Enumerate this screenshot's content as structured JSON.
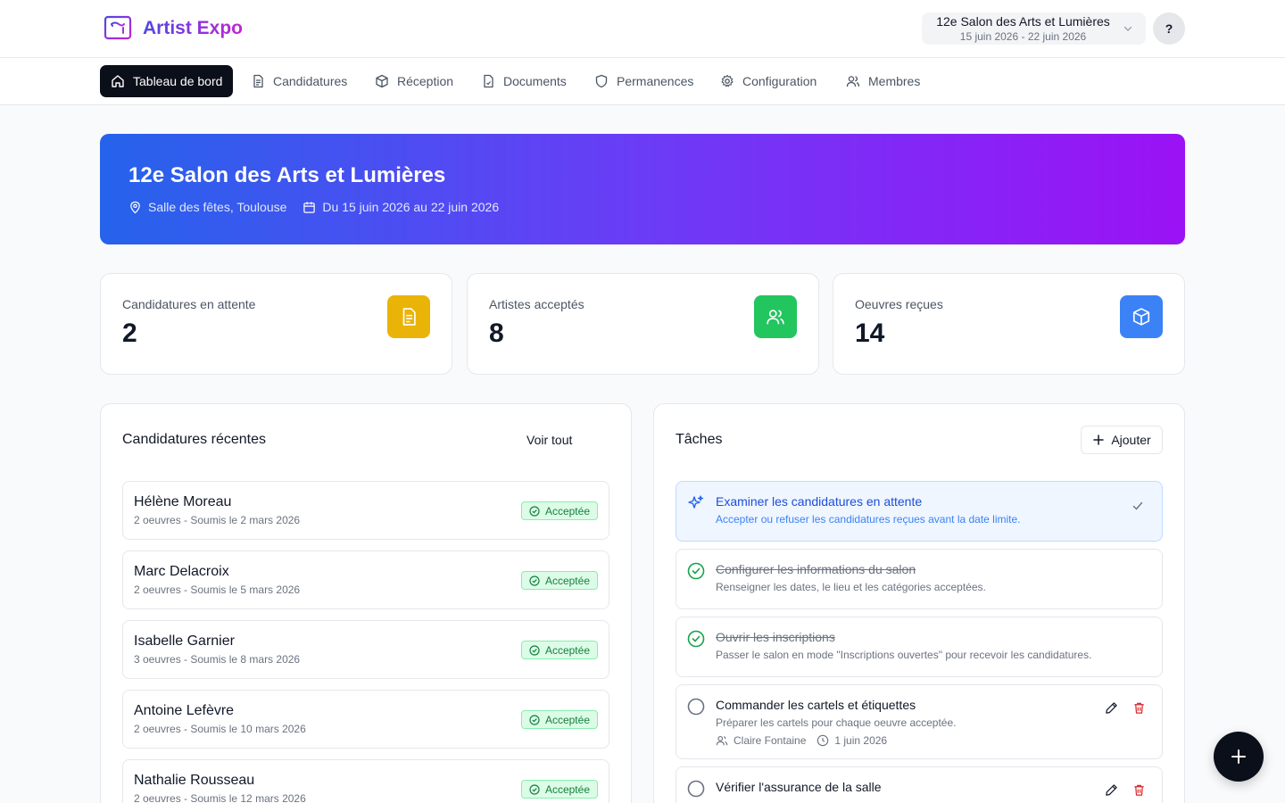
{
  "app": {
    "name": "Artist Expo"
  },
  "event_selector": {
    "name": "12e Salon des Arts et Lumières",
    "dates": "15 juin 2026 - 22 juin 2026"
  },
  "help": {
    "label": "?"
  },
  "nav": {
    "tabs": [
      {
        "label": "Tableau de bord",
        "icon": "home-icon",
        "active": true
      },
      {
        "label": "Candidatures",
        "icon": "document-icon"
      },
      {
        "label": "Réception",
        "icon": "package-icon"
      },
      {
        "label": "Documents",
        "icon": "file-icon"
      },
      {
        "label": "Permanences",
        "icon": "shield-icon"
      },
      {
        "label": "Configuration",
        "icon": "gear-icon"
      },
      {
        "label": "Membres",
        "icon": "users-icon"
      }
    ]
  },
  "banner": {
    "title": "12e Salon des Arts et Lumières",
    "location": "Salle des fêtes, Toulouse",
    "dates": "Du 15 juin 2026 au 22 juin 2026"
  },
  "stats": [
    {
      "label": "Candidatures en attente",
      "value": "2",
      "color": "#eab308",
      "icon": "document-icon"
    },
    {
      "label": "Artistes acceptés",
      "value": "8",
      "color": "#22c55e",
      "icon": "users-icon"
    },
    {
      "label": "Oeuvres reçues",
      "value": "14",
      "color": "#3b82f6",
      "icon": "package-icon"
    }
  ],
  "recent": {
    "title": "Candidatures récentes",
    "see_all": "Voir tout",
    "items": [
      {
        "name": "Hélène Moreau",
        "sub": "2 oeuvres - Soumis le 2 mars 2026",
        "status": "Acceptée"
      },
      {
        "name": "Marc Delacroix",
        "sub": "2 oeuvres - Soumis le 5 mars 2026",
        "status": "Acceptée"
      },
      {
        "name": "Isabelle Garnier",
        "sub": "3 oeuvres - Soumis le 8 mars 2026",
        "status": "Acceptée"
      },
      {
        "name": "Antoine Lefèvre",
        "sub": "2 oeuvres - Soumis le 10 mars 2026",
        "status": "Acceptée"
      },
      {
        "name": "Nathalie Rousseau",
        "sub": "2 oeuvres - Soumis le 12 mars 2026",
        "status": "Acceptée"
      }
    ]
  },
  "tasks": {
    "title": "Tâches",
    "add_label": "Ajouter",
    "items": [
      {
        "title": "Examiner les candidatures en attente",
        "desc": "Accepter ou refuser les candidatures reçues avant la date limite.",
        "state": "highlight"
      },
      {
        "title": "Configurer les informations du salon",
        "desc": "Renseigner les dates, le lieu et les catégories acceptées.",
        "state": "done"
      },
      {
        "title": "Ouvrir les inscriptions",
        "desc": "Passer le salon en mode \"Inscriptions ouvertes\" pour recevoir les candidatures.",
        "state": "done"
      },
      {
        "title": "Commander les cartels et étiquettes",
        "desc": "Préparer les cartels pour chaque oeuvre acceptée.",
        "assignee": "Claire Fontaine",
        "due": "1 juin 2026",
        "state": "todo"
      },
      {
        "title": "Vérifier l'assurance de la salle",
        "state": "todo"
      }
    ]
  }
}
